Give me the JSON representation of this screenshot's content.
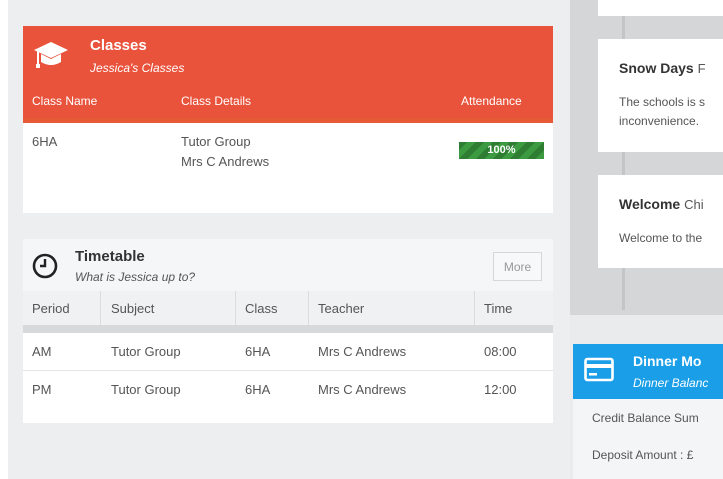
{
  "classes": {
    "title": "Classes",
    "subtitle": "Jessica's Classes",
    "columns": [
      "Class Name",
      "Class Details",
      "Attendance"
    ],
    "rows": [
      {
        "name": "6HA",
        "details": [
          "Tutor Group",
          "Mrs C Andrews"
        ],
        "attendance": "100%",
        "attendance_fraction": 1.0
      }
    ],
    "colors": {
      "header": "#e9533c",
      "attendance_bar": "#2e7d32"
    }
  },
  "timetable": {
    "title": "Timetable",
    "subtitle": "What is Jessica up to?",
    "more_label": "More",
    "columns": [
      "Period",
      "Subject",
      "Class",
      "Teacher",
      "Time"
    ],
    "rows": [
      [
        "AM",
        "Tutor Group",
        "6HA",
        "Mrs C Andrews",
        "08:00"
      ],
      [
        "PM",
        "Tutor Group",
        "6HA",
        "Mrs C Andrews",
        "12:00"
      ]
    ]
  },
  "timeline": [
    {
      "title": "Snow Days",
      "title_extra": "F",
      "text": [
        "The schools is s",
        "inconvenience."
      ]
    },
    {
      "title": "Welcome",
      "title_extra": "Chi",
      "text": [
        "Welcome to the"
      ]
    }
  ],
  "dinner": {
    "title": "Dinner Mo",
    "subtitle": "Dinner Balanc",
    "credit_label": "Credit Balance Sum",
    "deposit_label": "Deposit Amount : £",
    "colors": {
      "header": "#1a9ee8"
    }
  },
  "icons": [
    "graduation-cap-icon",
    "clock-icon",
    "payment-card-icon"
  ]
}
